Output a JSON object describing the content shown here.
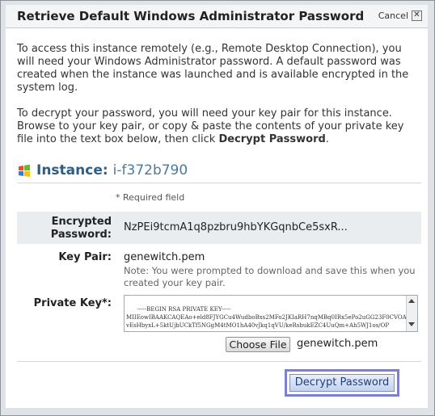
{
  "dialog": {
    "title": "Retrieve Default Windows Administrator Password",
    "cancel_label": "Cancel",
    "close_glyph": "✕"
  },
  "intro": {
    "p1": "To access this instance remotely (e.g., Remote Desktop Connection), you will need your Windows Administrator password. A default password was created when the instance was launched and is available encrypted in the system log.",
    "p2_prefix": "To decrypt your password, you will need your key pair for this instance. Browse to your key pair, or copy & paste the contents of your private key file into the text box below, then click ",
    "p2_bold": "Decrypt Password",
    "p2_suffix": "."
  },
  "instance": {
    "label": "Instance:",
    "id": "i-f372b790",
    "icon": "windows-icon"
  },
  "required_note": "* Required field",
  "encrypted_password": {
    "label": "Encrypted Password:",
    "value": "NzPEi9tcmA1q8pzbru9hbYKGqnbCe5sxR..."
  },
  "key_pair": {
    "label": "Key Pair:",
    "value": "genewitch.pem",
    "note": "Note: You were prompted to download and save this when you created your key pair."
  },
  "private_key": {
    "label": "Private Key*:",
    "text": "-----BEGIN RSA PRIVATE KEY-----\nMIIEowIBAAKCAQEAo+eld8FJYGCu4WudboBxs2MFo2JKIaRH7nqMBq0IRx5ePo2uGG23F0CVOAFf\nvEsHbyxL+5ktUjbUCkTf5NGgM4tMO1hA40vJkq1qVU/keRsbukEZC4UuQm+Ah5WJ1os/OP",
    "choose_label": "Choose File",
    "filename": "genewitch.pem"
  },
  "decrypt_button": "Decrypt Password",
  "colors": {
    "title_text": "#222222",
    "instance_label": "#2c5f87",
    "focus_ring": "#7b7fd6"
  }
}
